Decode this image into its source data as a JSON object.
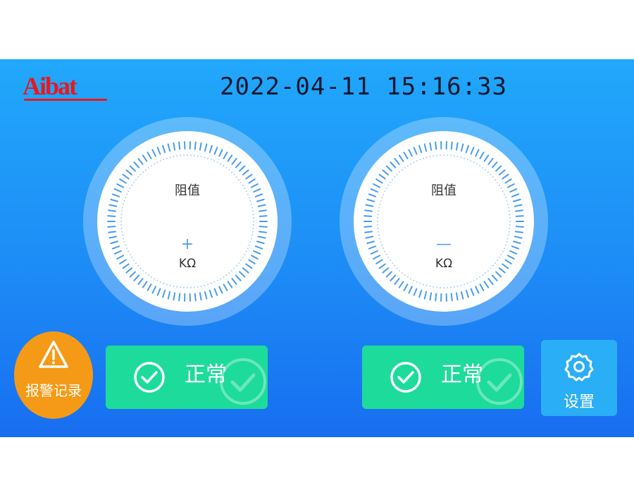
{
  "header": {
    "logo_text": "Aibat",
    "datetime": "2022-04-11 15:16:33"
  },
  "gauges": [
    {
      "label": "阻值",
      "sign": "+",
      "unit": "KΩ"
    },
    {
      "label": "阻值",
      "sign": "—",
      "unit": "KΩ"
    }
  ],
  "alarm": {
    "label": "报警记录"
  },
  "status": [
    {
      "text": "正常"
    },
    {
      "text": "正常"
    }
  ],
  "settings": {
    "label": "设置"
  },
  "colors": {
    "logo": "#e8181e",
    "alarm": "#f59a16",
    "status_ok": "#1ddb9a",
    "settings": "#2aaef5",
    "tick": "#4a9cf0"
  }
}
